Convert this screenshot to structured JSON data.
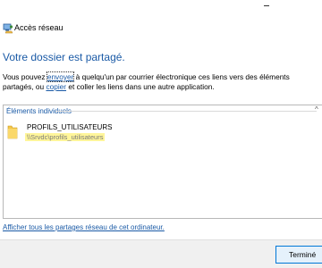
{
  "window": {
    "title": "Accès réseau",
    "app_icon": "network-access-icon"
  },
  "main": {
    "heading": "Votre dossier est partagé.",
    "description": {
      "part1": "Vous pouvez ",
      "link_send": "envoyer",
      "part2": " à quelqu'un par courrier électronique ces liens vers des éléments partagés, ou ",
      "link_copy": "copier",
      "part3": " et coller les liens dans une autre application."
    }
  },
  "items_group": {
    "header": "Éléments individuels",
    "items": [
      {
        "name": "PROFILS_UTILISATEURS",
        "path": "\\\\Srvdc\\profils_utilisateurs",
        "icon": "folder-icon"
      }
    ]
  },
  "footer": {
    "show_all_link": "Afficher tous les partages réseau de cet ordinateur.",
    "finish_button": "Terminé"
  },
  "colors": {
    "accent": "#1a5aa6",
    "highlight": "#fff59a"
  }
}
